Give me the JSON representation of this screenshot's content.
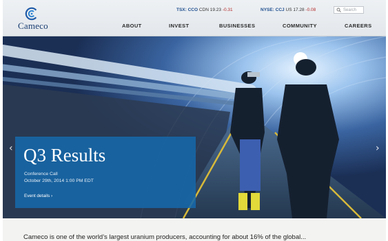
{
  "brand": {
    "name": "Cameco"
  },
  "tickers": [
    {
      "exchange": "TSX: CCO",
      "quote": "CDN 19.23",
      "change": "-0.31"
    },
    {
      "exchange": "NYSE: CCJ",
      "quote": "US 17.28",
      "change": "-0.08"
    }
  ],
  "search": {
    "placeholder": "Search"
  },
  "nav": {
    "items": [
      "ABOUT",
      "INVEST",
      "BUSINESSES",
      "COMMUNITY",
      "CAREERS"
    ]
  },
  "hero": {
    "title": "Q3 Results",
    "subtitle": "Conference Call",
    "date": "October 29th, 2014 1:00 PM EDT",
    "link": "Event details ›",
    "prev": "‹",
    "next": "›"
  },
  "intro": {
    "text": "Cameco is one of the world’s largest uranium producers, accounting for about 16% of the global..."
  },
  "colors": {
    "brand_blue": "#1a3d72",
    "promo_blue": "#1668aa",
    "down": "#b22a2a"
  }
}
